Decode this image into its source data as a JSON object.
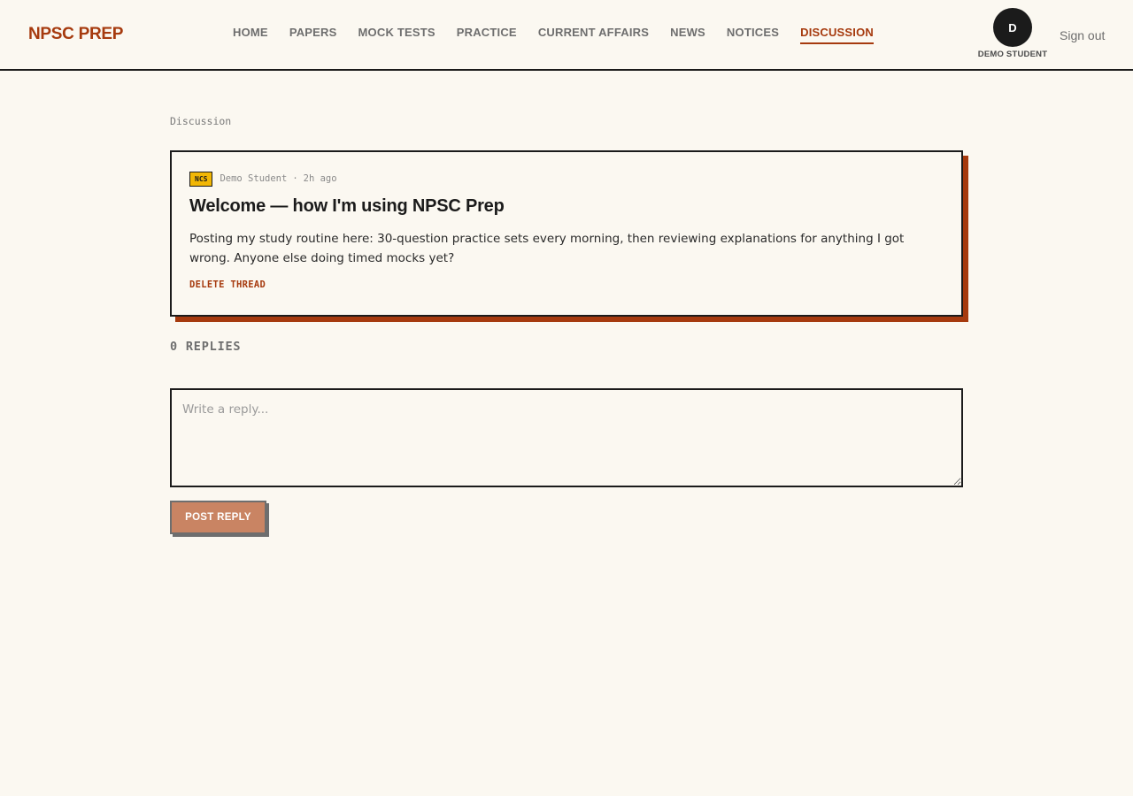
{
  "brand": {
    "name": "NPSC PREP",
    "accent_color": "#a63a0e"
  },
  "nav": {
    "items": [
      {
        "label": "HOME",
        "active": false
      },
      {
        "label": "PAPERS",
        "active": false
      },
      {
        "label": "MOCK TESTS",
        "active": false
      },
      {
        "label": "PRACTICE",
        "active": false
      },
      {
        "label": "CURRENT AFFAIRS",
        "active": false
      },
      {
        "label": "NEWS",
        "active": false
      },
      {
        "label": "NOTICES",
        "active": false
      },
      {
        "label": "DISCUSSION",
        "active": true
      }
    ]
  },
  "user": {
    "initial": "D",
    "name": "DEMO STUDENT",
    "signout_label": "Sign out"
  },
  "breadcrumb": "Discussion",
  "thread": {
    "tag": "NCS",
    "tag_color": "#f2b705",
    "author": "Demo Student",
    "separator": "·",
    "time": "2h ago",
    "title": "Welcome — how I'm using NPSC Prep",
    "body": "Posting my study routine here: 30-question practice sets every morning, then reviewing explanations for anything I got wrong. Anyone else doing timed mocks yet?",
    "delete_label": "DELETE THREAD"
  },
  "replies": {
    "count_label": "0 REPLIES"
  },
  "reply_form": {
    "placeholder": "Write a reply...",
    "value": "",
    "submit_label": "POST REPLY"
  }
}
